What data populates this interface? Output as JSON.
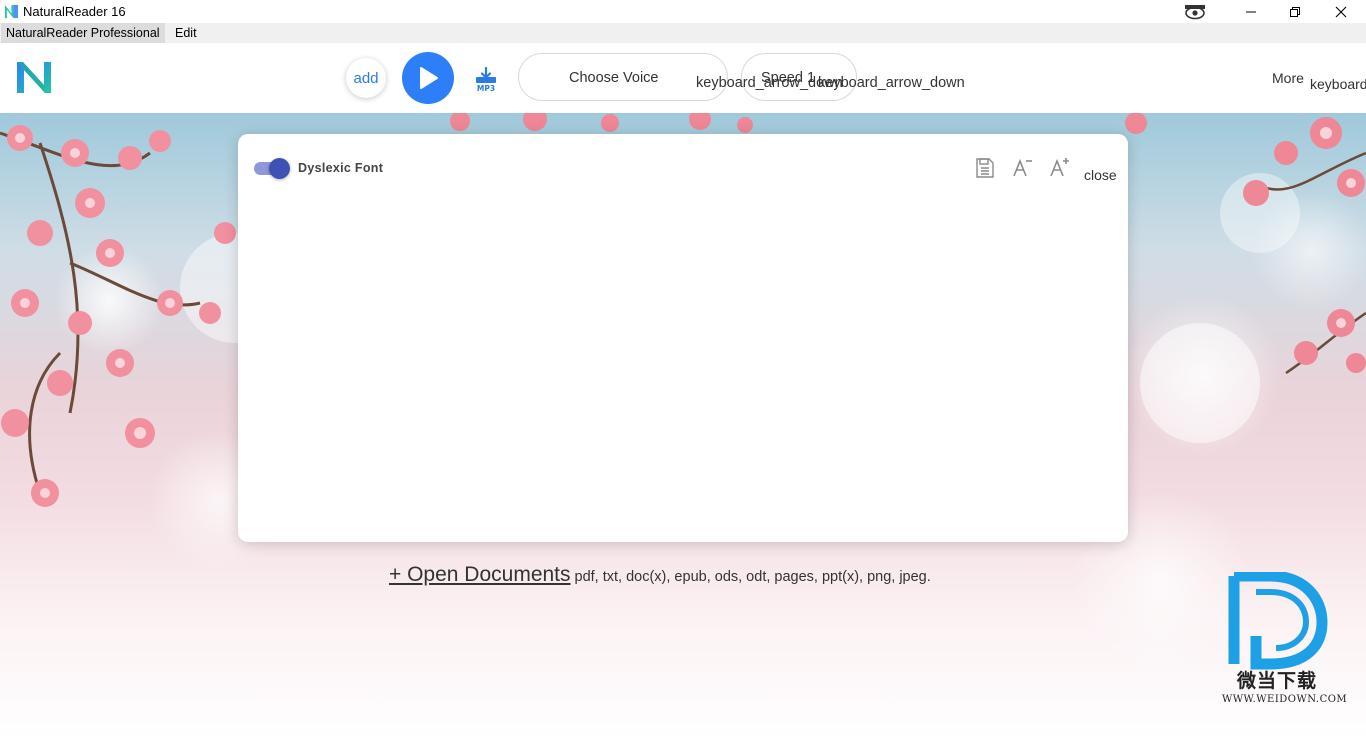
{
  "window": {
    "title": "NaturalReader 16",
    "icons": {
      "app": "naturalreader-icon",
      "eye": "eye-icon",
      "minimize": "minimize-icon",
      "restore": "restore-icon",
      "close": "close-icon"
    }
  },
  "menubar": {
    "items": [
      {
        "label": "NaturalReader Professional"
      },
      {
        "label": "Edit"
      }
    ]
  },
  "toolbar": {
    "add_label": "add",
    "mp3_label": "MP3",
    "voice": {
      "label": "Choose Voice",
      "arrow_text": "keyboard_arrow_down"
    },
    "speed": {
      "label": "Speed 1",
      "arrow_text": "keyboard_arrow_down"
    },
    "more": {
      "label": "More",
      "arrow_text": "keyboard"
    }
  },
  "editor": {
    "dyslexic_font_label": "Dyslexic Font",
    "dyslexic_font_on": true,
    "close_label": "close"
  },
  "open_documents": {
    "link_label": "+ Open Documents",
    "formats": "pdf, txt, doc(x), epub, ods, odt, pages, ppt(x), png, jpeg."
  },
  "watermark": {
    "chinese": "微当下载",
    "url": "WWW.WEIDOWN.COM"
  },
  "colors": {
    "accent_blue": "#2d7ff9",
    "toggle_knob": "#3f51b5",
    "toggle_track": "#8f97d8",
    "mp3_blue": "#2a7be4",
    "watermark_blue": "#1ea0e6"
  }
}
